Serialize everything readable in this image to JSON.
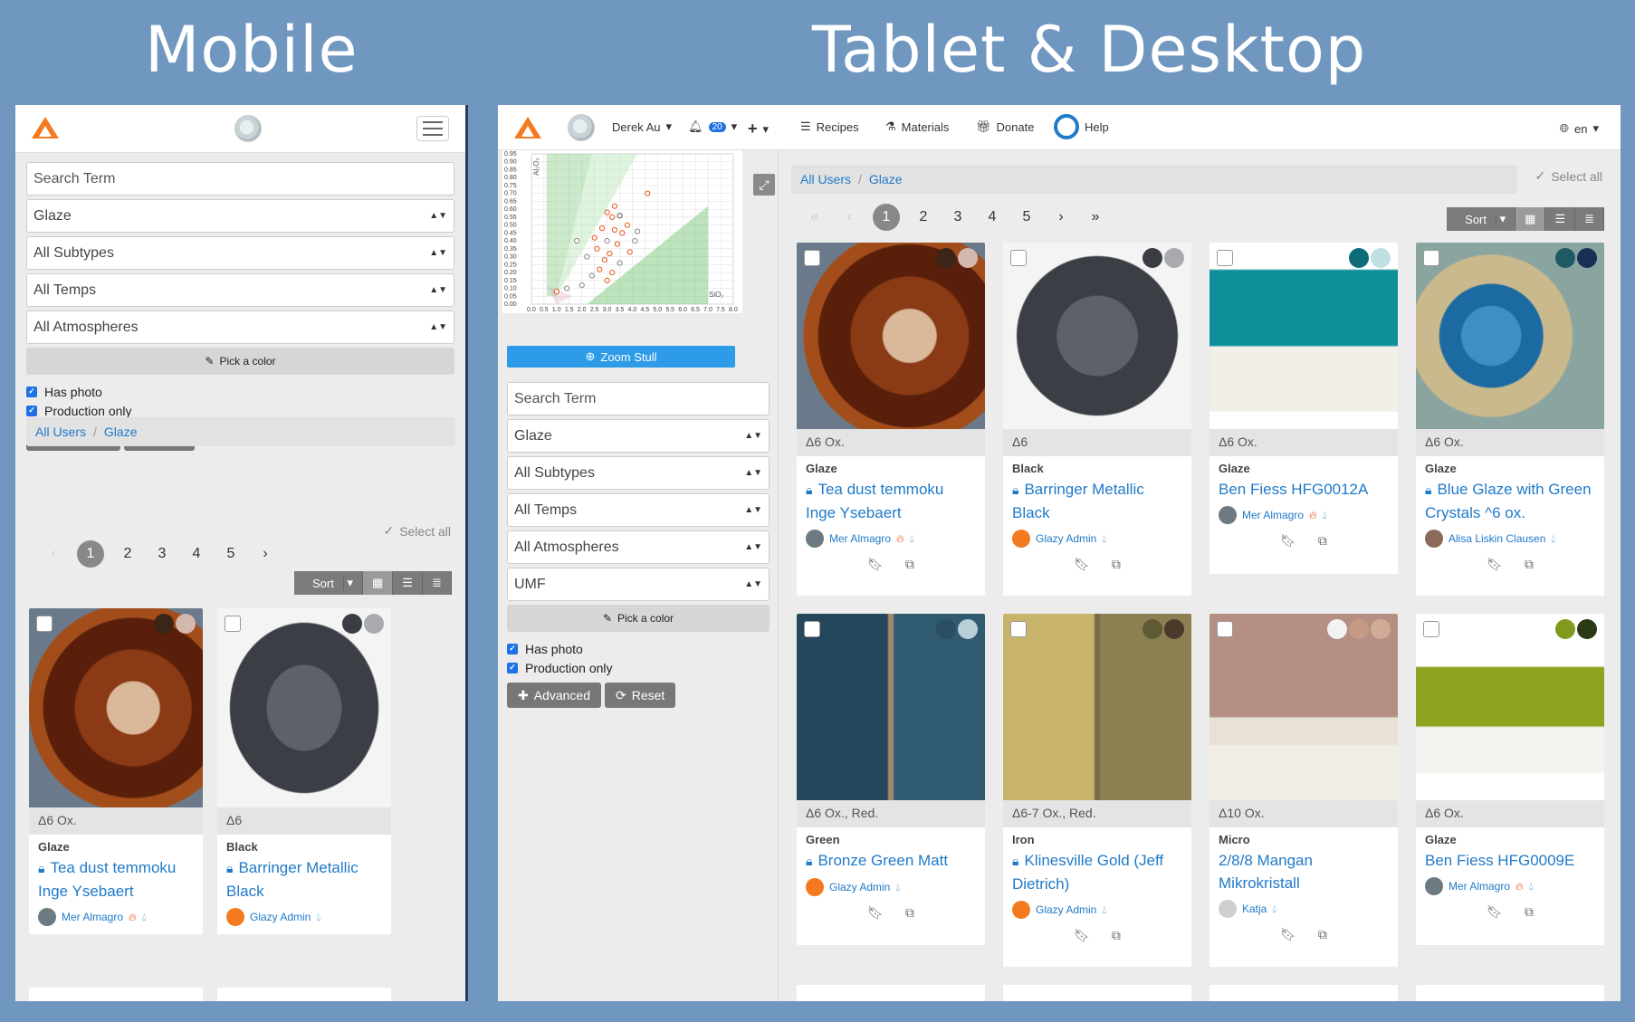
{
  "headings": {
    "mobile": "Mobile",
    "desktop": "Tablet & Desktop"
  },
  "filters": {
    "search_placeholder": "Search Term",
    "type": "Glaze",
    "subtypes": "All Subtypes",
    "temps": "All Temps",
    "atmospheres": "All Atmospheres",
    "umf": "UMF",
    "pick_color": "Pick a color",
    "has_photo": "Has photo",
    "production_only": "Production only",
    "advanced": "Advanced",
    "reset": "Reset"
  },
  "breadcrumb": {
    "users": "All Users",
    "sep": "/",
    "type": "Glaze"
  },
  "select_all": "Select all",
  "pager": {
    "prev_first": "«",
    "prev": "‹",
    "pages": [
      "1",
      "2",
      "3",
      "4",
      "5"
    ],
    "next": "›",
    "next_last": "»"
  },
  "sort": "Sort",
  "nav": {
    "user": "Derek Au",
    "notifications": "20",
    "recipes": "Recipes",
    "materials": "Materials",
    "donate": "Donate",
    "help": "Help",
    "lang": "en"
  },
  "chart": {
    "zoom": "Zoom Stull",
    "y_label": "Al₂O₃",
    "x_label": "SiO₂",
    "y_ticks": [
      "0.95",
      "0.90",
      "0.85",
      "0.80",
      "0.75",
      "0.70",
      "0.65",
      "0.60",
      "0.55",
      "0.50",
      "0.45",
      "0.40",
      "0.35",
      "0.30",
      "0.25",
      "0.20",
      "0.15",
      "0.10",
      "0.05",
      "0.00"
    ],
    "x_ticks": [
      "0.0",
      "0.5",
      "1.0",
      "1.5",
      "2.0",
      "2.5",
      "3.0",
      "3.5",
      "4.0",
      "4.5",
      "5.0",
      "5.5",
      "6.0",
      "6.5",
      "7.0",
      "7.5",
      "8.0"
    ]
  },
  "cards": [
    {
      "temp": "Δ6 Ox.",
      "type": "Glaze",
      "name": "Tea dust temmoku Inge Ysebaert",
      "user": "Mer Almagro",
      "locked": true,
      "sw": [
        "#3b2418",
        "#d3b8ae"
      ],
      "img": "tea"
    },
    {
      "temp": "Δ6",
      "type": "Black",
      "name": "Barringer Metallic Black",
      "user": "Glazy Admin",
      "locked": true,
      "sw": [
        "#3a3d42",
        "#a8aaae"
      ],
      "img": "black"
    },
    {
      "temp": "Δ6 Ox.",
      "type": "Glaze",
      "name": "Ben Fiess HFG0012A",
      "user": "Mer Almagro",
      "locked": false,
      "sw": [
        "#0e6c78",
        "#bfe0e2"
      ],
      "img": "teal"
    },
    {
      "temp": "Δ6 Ox.",
      "type": "Glaze",
      "name": "Blue Glaze with Green Crystals ^6 ox.",
      "user": "Alisa Liskin Clausen",
      "locked": true,
      "sw": [
        "#1f5a63",
        "#1a2f55"
      ],
      "img": "blue"
    },
    {
      "temp": "Δ6 Ox., Red.",
      "type": "Green",
      "name": "Bronze Green Matt",
      "user": "Glazy Admin",
      "locked": true,
      "sw": [
        "#2a4f63",
        "#b8cfd8"
      ],
      "img": "tiles"
    },
    {
      "temp": "Δ6-7 Ox., Red.",
      "type": "Iron",
      "name": "Klinesville Gold (Jeff Dietrich)",
      "user": "Glazy Admin",
      "locked": true,
      "sw": [
        "#5e5a36",
        "#4a3a2a"
      ],
      "img": "gold"
    },
    {
      "temp": "Δ10 Ox.",
      "type": "Micro",
      "name": "2/8/8 Mangan Mikrokristall",
      "user": "Katja",
      "locked": false,
      "sw": [
        "#f2f2f2",
        "#c79a86",
        "#d2ab98"
      ],
      "img": "mangan"
    },
    {
      "temp": "Δ6 Ox.",
      "type": "Glaze",
      "name": "Ben Fiess HFG0009E",
      "user": "Mer Almagro",
      "locked": false,
      "sw": [
        "#7f9a1e",
        "#2a3a14"
      ],
      "img": "green"
    }
  ]
}
